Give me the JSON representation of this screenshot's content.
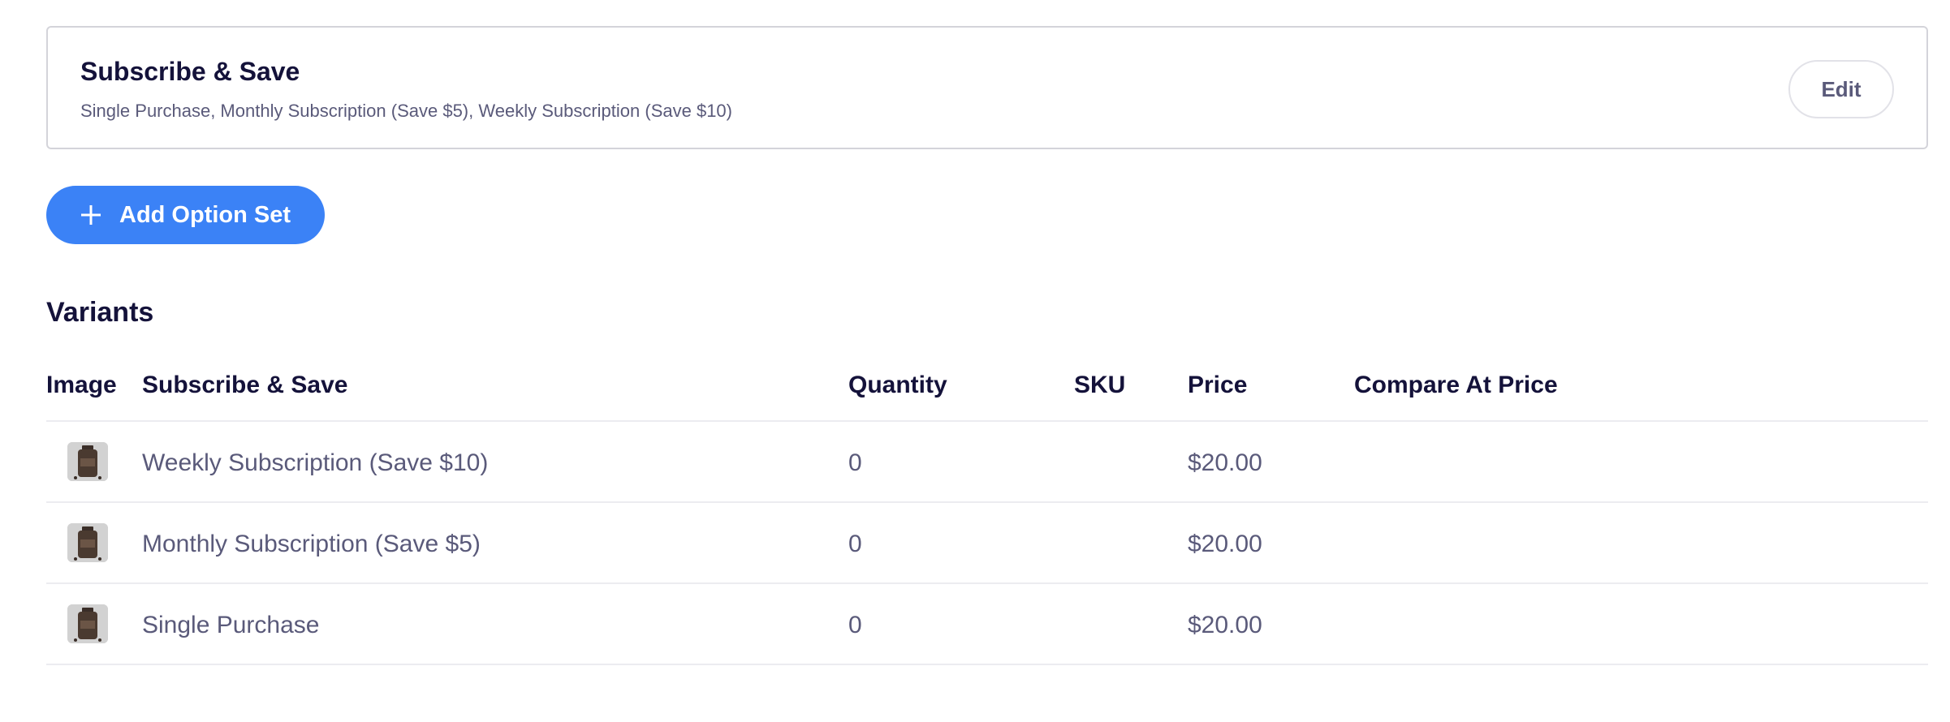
{
  "option_set": {
    "title": "Subscribe & Save",
    "subtitle": "Single Purchase, Monthly Subscription (Save $5), Weekly Subscription (Save $10)",
    "edit_label": "Edit"
  },
  "add_option_set": {
    "icon": "plus-icon",
    "label": "Add Option Set"
  },
  "variants": {
    "heading": "Variants",
    "columns": [
      "Image",
      "Subscribe & Save",
      "Quantity",
      "SKU",
      "Price",
      "Compare At Price"
    ],
    "rows": [
      {
        "thumbnail": "product-bottle-thumbnail",
        "name": "Weekly Subscription (Save $10)",
        "quantity": "0",
        "sku": "",
        "price": "$20.00",
        "compare_at_price": ""
      },
      {
        "thumbnail": "product-bottle-thumbnail",
        "name": "Monthly Subscription (Save $5)",
        "quantity": "0",
        "sku": "",
        "price": "$20.00",
        "compare_at_price": ""
      },
      {
        "thumbnail": "product-bottle-thumbnail",
        "name": "Single Purchase",
        "quantity": "0",
        "sku": "",
        "price": "$20.00",
        "compare_at_price": ""
      }
    ]
  },
  "colors": {
    "primary_button": "#3b82f6",
    "heading_text": "#14123a",
    "muted_text": "#5a5a7a",
    "border": "#d4d4da"
  }
}
